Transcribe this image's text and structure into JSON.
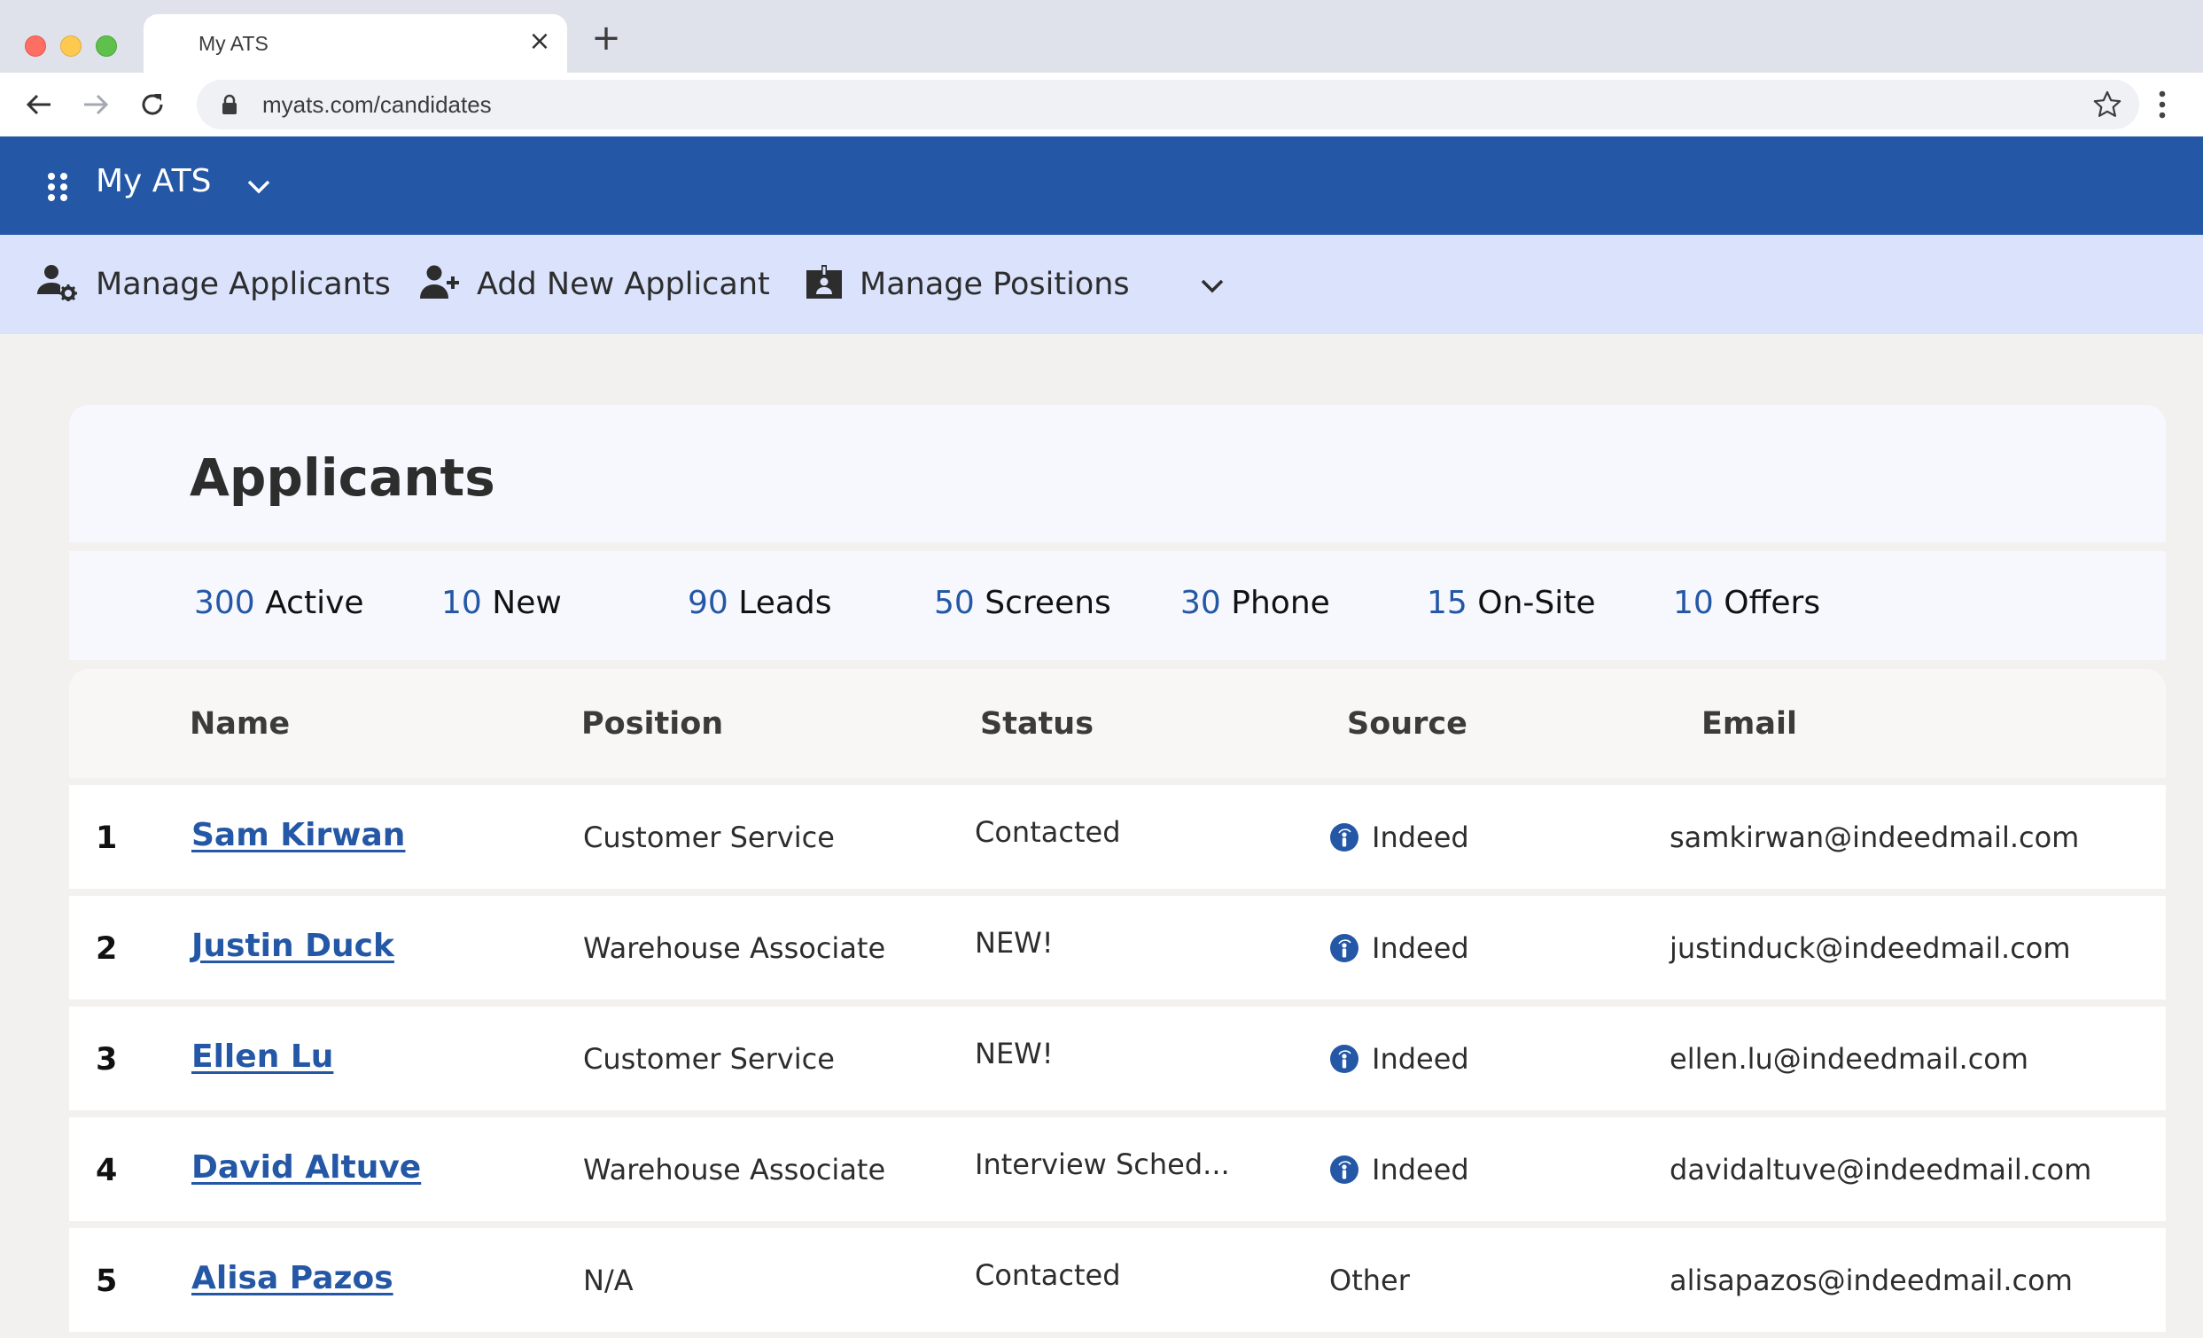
{
  "browser": {
    "tab_title": "My ATS",
    "url": "myats.com/candidates"
  },
  "app": {
    "title": "My ATS"
  },
  "subnav": {
    "items": [
      {
        "label": "Manage Applicants",
        "icon": "user-gear-icon"
      },
      {
        "label": "Add New Applicant",
        "icon": "user-plus-icon"
      },
      {
        "label": "Manage Positions",
        "icon": "id-badge-icon"
      }
    ]
  },
  "page": {
    "title": "Applicants"
  },
  "stats": [
    {
      "count": "300",
      "label": "Active"
    },
    {
      "count": "10",
      "label": "New"
    },
    {
      "count": "90",
      "label": "Leads"
    },
    {
      "count": "50",
      "label": "Screens"
    },
    {
      "count": "30",
      "label": "Phone"
    },
    {
      "count": "15",
      "label": "On-Site"
    },
    {
      "count": "10",
      "label": "Offers"
    }
  ],
  "table": {
    "columns": [
      "Name",
      "Position",
      "Status",
      "Source",
      "Email"
    ],
    "rows": [
      {
        "index": "1",
        "name": "Sam Kirwan",
        "position": "Customer Service",
        "status": "Contacted",
        "source": "Indeed",
        "source_icon": "indeed-icon",
        "email": "samkirwan@indeedmail.com"
      },
      {
        "index": "2",
        "name": "Justin Duck",
        "position": "Warehouse Associate",
        "status": "NEW!",
        "source": "Indeed",
        "source_icon": "indeed-icon",
        "email": "justinduck@indeedmail.com"
      },
      {
        "index": "3",
        "name": "Ellen Lu",
        "position": "Customer Service",
        "status": "NEW!",
        "source": "Indeed",
        "source_icon": "indeed-icon",
        "email": "ellen.lu@indeedmail.com"
      },
      {
        "index": "4",
        "name": "David Altuve",
        "position": "Warehouse Associate",
        "status": "Interview Sched...",
        "source": "Indeed",
        "source_icon": "indeed-icon",
        "email": "davidaltuve@indeedmail.com"
      },
      {
        "index": "5",
        "name": "Alisa Pazos",
        "position": "N/A",
        "status": "Contacted",
        "source": "Other",
        "source_icon": "",
        "email": "alisapazos@indeedmail.com"
      }
    ]
  },
  "colors": {
    "brand": "#2457a5",
    "subnav_bg": "#dae2fc",
    "page_bg": "#f2f1ef"
  }
}
